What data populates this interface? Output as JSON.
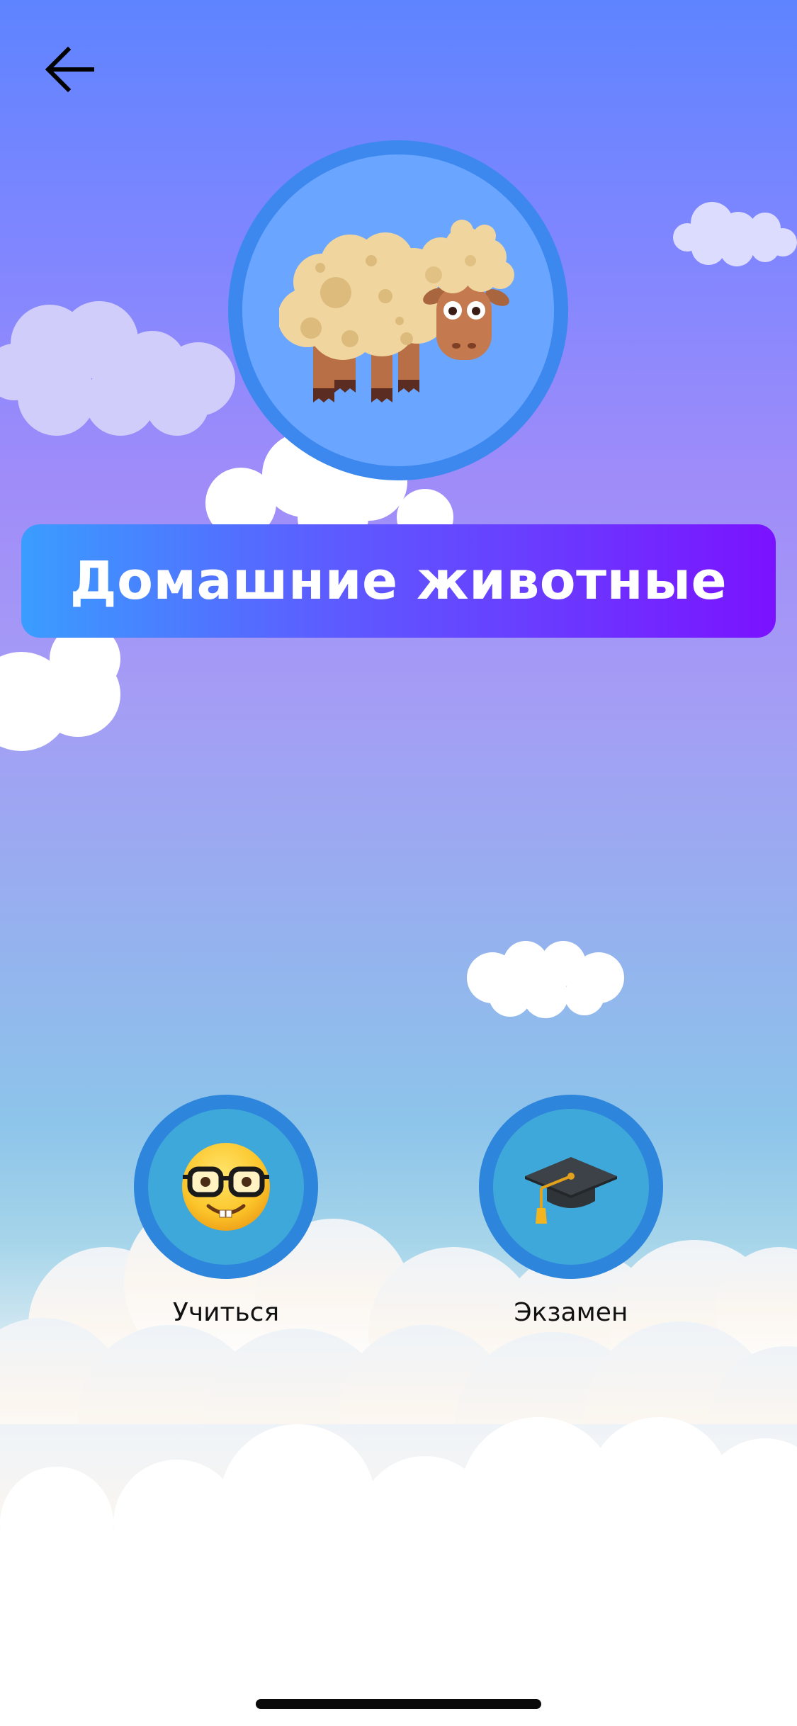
{
  "header": {
    "back_icon": "arrow-left-icon"
  },
  "hero": {
    "icon": "sheep-icon",
    "circle_color": "#6aa6ff",
    "ring_color": "#3d88ee"
  },
  "title": {
    "text": "Домашние животные",
    "gradient_start": "#3a9dff",
    "gradient_end": "#7b12ff"
  },
  "modes": [
    {
      "label": "Учиться",
      "icon": "nerd-face-icon"
    },
    {
      "label": "Экзамен",
      "icon": "graduation-cap-icon"
    }
  ]
}
